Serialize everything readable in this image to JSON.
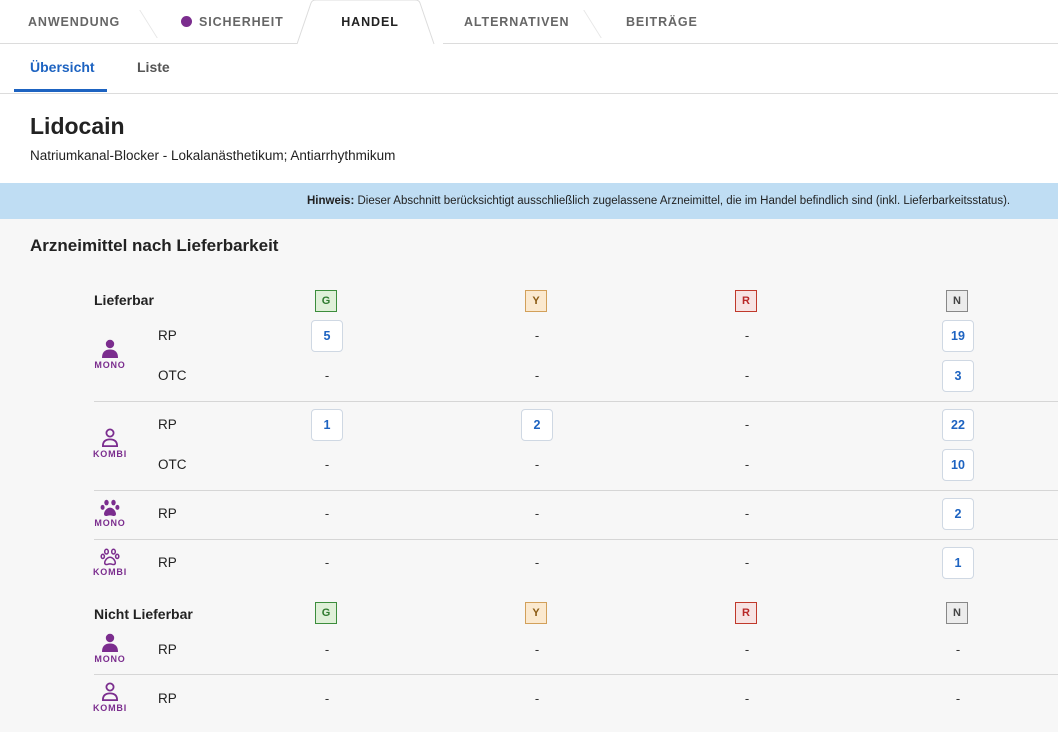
{
  "top_tabs": {
    "anwendung": "ANWENDUNG",
    "sicherheit": "SICHERHEIT",
    "handel": "HANDEL",
    "alternativen": "ALTERNATIVEN",
    "beitraege": "BEITRÄGE",
    "active": "HANDEL",
    "dot_color": "#7b2d8e"
  },
  "sub_tabs": {
    "uebersicht": "Übersicht",
    "liste": "Liste",
    "active": "Übersicht"
  },
  "drug": {
    "name": "Lidocain",
    "description": "Natriumkanal-Blocker - Lokalanästhetikum; Antiarrhythmikum"
  },
  "banner": {
    "label": "Hinweis:",
    "text": " Dieser Abschnitt berücksichtigt ausschließlich zugelassene Arzneimittel, die im Handel befindlich sind (inkl. Lieferbarkeitsstatus)."
  },
  "section": {
    "title": "Arzneimittel nach Lieferbarkeit"
  },
  "status_columns": [
    "G",
    "Y",
    "R",
    "N"
  ],
  "groups": [
    {
      "label": "Lieferbar",
      "types": [
        {
          "icon": "person-filled-icon",
          "type_label": "MONO",
          "rows": [
            {
              "rx": "RP",
              "values": [
                "5",
                "-",
                "-",
                "19"
              ]
            },
            {
              "rx": "OTC",
              "values": [
                "-",
                "-",
                "-",
                "3"
              ]
            }
          ]
        },
        {
          "icon": "person-outline-icon",
          "type_label": "KOMBI",
          "rows": [
            {
              "rx": "RP",
              "values": [
                "1",
                "2",
                "-",
                "22"
              ]
            },
            {
              "rx": "OTC",
              "values": [
                "-",
                "-",
                "-",
                "10"
              ]
            }
          ]
        },
        {
          "icon": "paw-filled-icon",
          "type_label": "MONO",
          "rows": [
            {
              "rx": "RP",
              "values": [
                "-",
                "-",
                "-",
                "2"
              ]
            }
          ]
        },
        {
          "icon": "paw-outline-icon",
          "type_label": "KOMBI",
          "rows": [
            {
              "rx": "RP",
              "values": [
                "-",
                "-",
                "-",
                "1"
              ]
            }
          ]
        }
      ]
    },
    {
      "label": "Nicht Lieferbar",
      "types": [
        {
          "icon": "person-filled-icon",
          "type_label": "MONO",
          "rows": [
            {
              "rx": "RP",
              "values": [
                "-",
                "-",
                "-",
                "-"
              ]
            }
          ]
        },
        {
          "icon": "person-outline-icon",
          "type_label": "KOMBI",
          "rows": [
            {
              "rx": "RP",
              "values": [
                "-",
                "-",
                "-",
                "-"
              ]
            }
          ]
        }
      ]
    }
  ],
  "colors": {
    "accent": "#1d63c1",
    "icon_purple": "#7b2d8e",
    "banner": "#bfddf3",
    "status_g": "#3c8d3c",
    "status_y": "#d2a05a",
    "status_r": "#c0392b",
    "status_n": "#888888"
  }
}
